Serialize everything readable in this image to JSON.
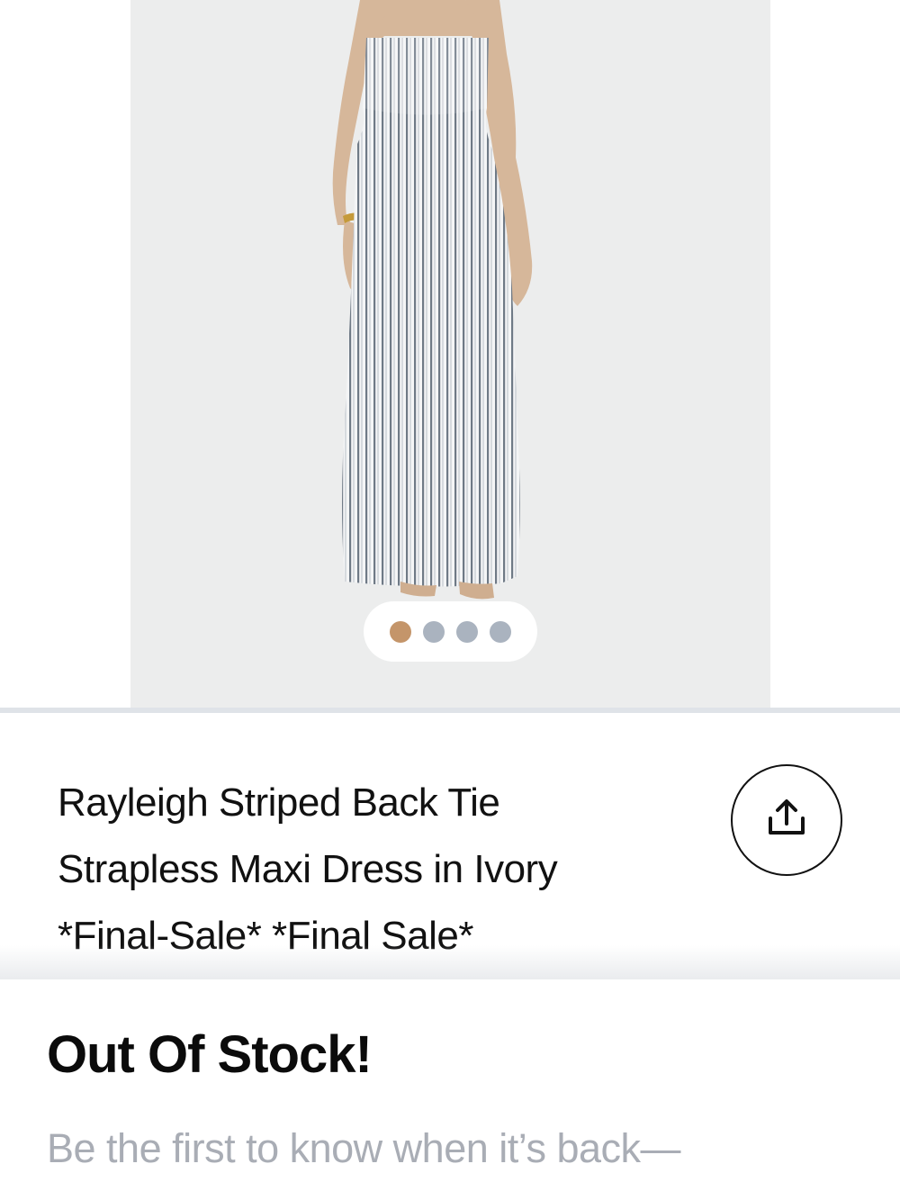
{
  "gallery": {
    "image_alt": "Model wearing striped strapless maxi dress",
    "slide_count": 4,
    "active_slide": 1,
    "active_dot_color": "#c4956a",
    "inactive_dot_color": "#aab3bf"
  },
  "product": {
    "title_line1": "Rayleigh Striped Back Tie",
    "title_line2": "Strapless Maxi Dress in Ivory",
    "title_line3": "*Final-Sale* *Final Sale*",
    "share_icon": "share-icon"
  },
  "stock": {
    "heading": "Out Of Stock!",
    "subtext": "Be the first to know when it’s back—"
  }
}
